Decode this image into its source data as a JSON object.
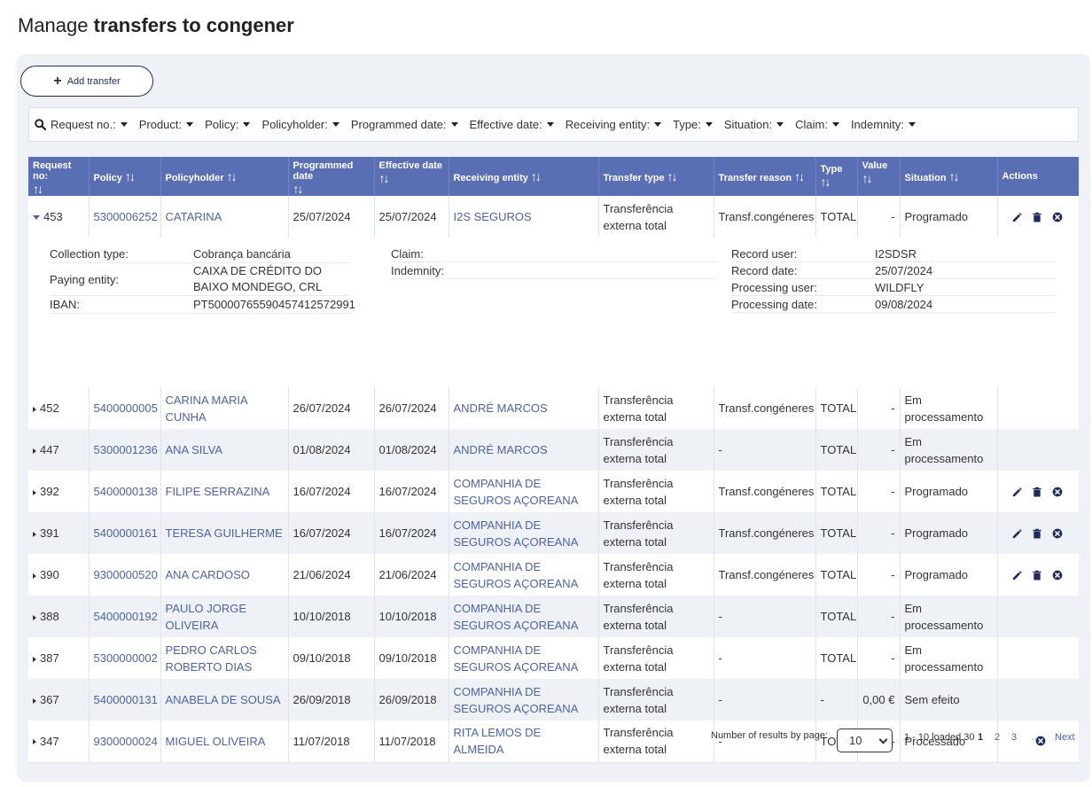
{
  "title": {
    "prefix": "Manage",
    "bold": "transfers to congener"
  },
  "add_button": {
    "icon": "+",
    "label": "Add transfer"
  },
  "filters": [
    {
      "label": "Request no.:"
    },
    {
      "label": "Product:"
    },
    {
      "label": "Policy:"
    },
    {
      "label": "Policyholder:"
    },
    {
      "label": "Programmed date:"
    },
    {
      "label": "Effective date:"
    },
    {
      "label": "Receiving entity:"
    },
    {
      "label": "Type:"
    },
    {
      "label": "Situation:"
    },
    {
      "label": "Claim:"
    },
    {
      "label": "Indemnity:"
    }
  ],
  "columns": [
    "Request no:",
    "Policy",
    "Policyholder",
    "Programmed date",
    "Effective date",
    "Receiving entity",
    "Transfer type",
    "Transfer reason",
    "Type",
    "Value",
    "Situation",
    "Actions"
  ],
  "sort_glyph": "↑↓",
  "rows": [
    {
      "request": "453",
      "policy": "5300006252",
      "holder": "CATARINA",
      "programmed": "25/07/2024",
      "effective": "25/07/2024",
      "entity": "I2S SEGUROS",
      "transfer_type": "Transferência externa total",
      "reason": "Transf.congéneres",
      "type": "TOTAL",
      "value": "-",
      "situation": "Programado",
      "actions": [
        "edit",
        "delete",
        "cancel"
      ],
      "expanded": true
    },
    {
      "request": "452",
      "policy": "5400000005",
      "holder": "CARINA MARIA CUNHA",
      "programmed": "26/07/2024",
      "effective": "26/07/2024",
      "entity": "ANDRÉ MARCOS",
      "transfer_type": "Transferência externa total",
      "reason": "Transf.congéneres",
      "type": "TOTAL",
      "value": "-",
      "situation": "Em processamento",
      "actions": []
    },
    {
      "request": "447",
      "policy": "5300001236",
      "holder": "ANA SILVA",
      "programmed": "01/08/2024",
      "effective": "01/08/2024",
      "entity": "ANDRÉ MARCOS",
      "transfer_type": "Transferência externa total",
      "reason": "-",
      "type": "TOTAL",
      "value": "-",
      "situation": "Em processamento",
      "actions": []
    },
    {
      "request": "392",
      "policy": "5400000138",
      "holder": "FILIPE SERRAZINA",
      "programmed": "16/07/2024",
      "effective": "16/07/2024",
      "entity": "COMPANHIA DE SEGUROS AÇOREANA",
      "transfer_type": "Transferência externa total",
      "reason": "Transf.congéneres",
      "type": "TOTAL",
      "value": "-",
      "situation": "Programado",
      "actions": [
        "edit",
        "delete",
        "cancel"
      ]
    },
    {
      "request": "391",
      "policy": "5400000161",
      "holder": "TERESA GUILHERME",
      "programmed": "16/07/2024",
      "effective": "16/07/2024",
      "entity": "COMPANHIA DE SEGUROS AÇOREANA",
      "transfer_type": "Transferência externa total",
      "reason": "Transf.congéneres",
      "type": "TOTAL",
      "value": "-",
      "situation": "Programado",
      "actions": [
        "edit",
        "delete",
        "cancel"
      ]
    },
    {
      "request": "390",
      "policy": "9300000520",
      "holder": "ANA CARDOSO",
      "programmed": "21/06/2024",
      "effective": "21/06/2024",
      "entity": "COMPANHIA DE SEGUROS AÇOREANA",
      "transfer_type": "Transferência externa total",
      "reason": "Transf.congéneres",
      "type": "TOTAL",
      "value": "-",
      "situation": "Programado",
      "actions": [
        "edit",
        "delete",
        "cancel"
      ]
    },
    {
      "request": "388",
      "policy": "5400000192",
      "holder": "PAULO JORGE OLIVEIRA",
      "programmed": "10/10/2018",
      "effective": "10/10/2018",
      "entity": "COMPANHIA DE SEGUROS AÇOREANA",
      "transfer_type": "Transferência externa total",
      "reason": "-",
      "type": "TOTAL",
      "value": "-",
      "situation": "Em processamento",
      "actions": []
    },
    {
      "request": "387",
      "policy": "5300000002",
      "holder": "PEDRO CARLOS ROBERTO DIAS",
      "programmed": "09/10/2018",
      "effective": "09/10/2018",
      "entity": "COMPANHIA DE SEGUROS AÇOREANA",
      "transfer_type": "Transferência externa total",
      "reason": "-",
      "type": "TOTAL",
      "value": "-",
      "situation": "Em processamento",
      "actions": []
    },
    {
      "request": "367",
      "policy": "5400000131",
      "holder": "ANABELA DE SOUSA",
      "programmed": "26/09/2018",
      "effective": "26/09/2018",
      "entity": "COMPANHIA DE SEGUROS AÇOREANA",
      "transfer_type": "Transferência externa total",
      "reason": "-",
      "type": "-",
      "value": "0,00 €",
      "situation": "Sem efeito",
      "actions": []
    },
    {
      "request": "347",
      "policy": "9300000024",
      "holder": "MIGUEL OLIVEIRA",
      "programmed": "11/07/2018",
      "effective": "11/07/2018",
      "entity": "RITA LEMOS DE ALMEIDA",
      "transfer_type": "Transferência externa total",
      "reason": "-",
      "type": "TOTAL",
      "value": "-",
      "situation": "Processado",
      "actions": [
        "cancel"
      ]
    }
  ],
  "detail": {
    "left": [
      {
        "label": "Collection type:",
        "value": "Cobrança bancária",
        "link": false
      },
      {
        "label": "Paying entity:",
        "value": "CAIXA DE CRÉDITO DO BAIXO MONDEGO, CRL",
        "link": true
      },
      {
        "label": "IBAN:",
        "value": "PT50000765590457412572991",
        "link": false
      }
    ],
    "middle": [
      {
        "label": "Claim:",
        "value": ""
      },
      {
        "label": "Indemnity:",
        "value": ""
      }
    ],
    "right": [
      {
        "label": "Record user:",
        "value": "I2SDSR"
      },
      {
        "label": "Record date:",
        "value": "25/07/2024"
      },
      {
        "label": "Processing user:",
        "value": "WILDFLY"
      },
      {
        "label": "Processing date:",
        "value": "09/08/2024"
      }
    ]
  },
  "pagination": {
    "label": "Number of results by page:",
    "page_size": "10",
    "info": "1 - 10 loaded 30",
    "pages": [
      "1",
      "2",
      "3"
    ],
    "current": "1",
    "ellipsis": "...",
    "next": "Next"
  },
  "colors": {
    "header": "#5a6eb4",
    "link": "#4d63a6",
    "panel": "#eef1f6",
    "primary": "#1e2b5c"
  }
}
